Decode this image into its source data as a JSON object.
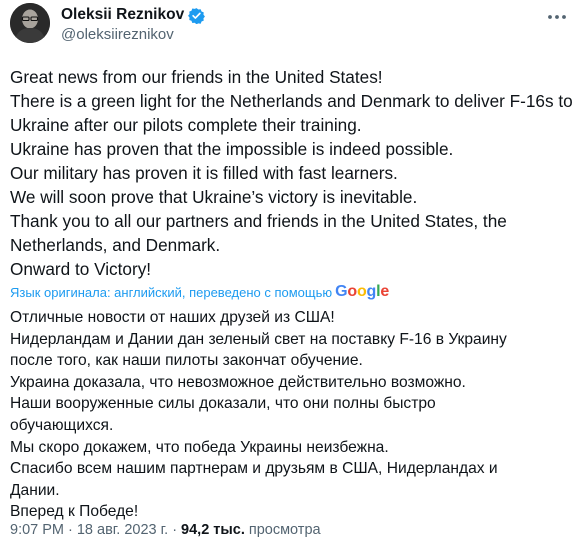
{
  "author": {
    "name": "Oleksii Reznikov",
    "handle": "@oleksiireznikov"
  },
  "tweet": {
    "lines_en": [
      "Great news from our friends in the United States!",
      "There is a green light for the Netherlands and Denmark to deliver F-16s to",
      "Ukraine after our pilots complete their training.",
      "Ukraine has proven that the impossible is indeed possible.",
      "Our military has proven it is filled with fast learners.",
      "We will soon prove that Ukraine’s victory is inevitable.",
      "Thank you to all our partners and friends in the United States, the",
      "Netherlands, and Denmark.",
      "Onward to Victory!"
    ],
    "translation_label": "Язык оригинала: английский, переведено с помощью",
    "lines_ru": [
      "Отличные новости от наших друзей из США!",
      "Нидерландам и Дании дан зеленый свет на поставку F-16 в Украину",
      "после того, как наши пилоты закончат обучение.",
      "Украина доказала, что невозможное действительно возможно.",
      "Наши вооруженные силы доказали, что они полны быстро",
      "обучающихся.",
      "Мы скоро докажем, что победа Украины неизбежна.",
      "Спасибо всем нашим партнерам и друзьям в США, Нидерландах и",
      "Дании.",
      "Вперед к Победе!"
    ]
  },
  "meta": {
    "time": "9:07 PM",
    "date": "18 авг. 2023 г.",
    "separator": "·",
    "views_count": "94,2 тыс.",
    "views_label": "просмотра"
  },
  "colors": {
    "verified_badge": "#1d9bf0",
    "link": "#1d9bf0",
    "secondary_text": "#536471"
  },
  "icons": [
    "verified-badge-icon",
    "more-options-icon",
    "google-logo"
  ]
}
